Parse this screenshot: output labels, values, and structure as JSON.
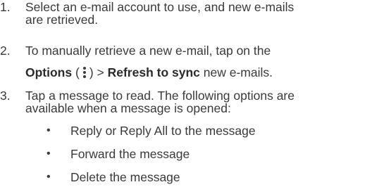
{
  "steps": [
    {
      "number": "1.",
      "lines": [
        "Select an e-mail account to use, and new e-mails",
        "are retrieved."
      ]
    },
    {
      "number": "2.",
      "line1": "To manually retrieve a new e-mail, tap on the",
      "options_label": "Options",
      "open_paren": "(",
      "close_paren": ") >",
      "refresh_label": "Refresh to sync",
      "tail": "new e-mails.",
      "icon": "kebab-menu-icon"
    },
    {
      "number": "3.",
      "lines": [
        "Tap a message to read. The following options are",
        "available when a message is opened:"
      ]
    }
  ],
  "bullets": [
    {
      "symbol": "•",
      "text": "Reply or Reply All to the message"
    },
    {
      "symbol": "•",
      "text": "Forward the message"
    },
    {
      "symbol": "•",
      "text": "Delete the message"
    }
  ]
}
